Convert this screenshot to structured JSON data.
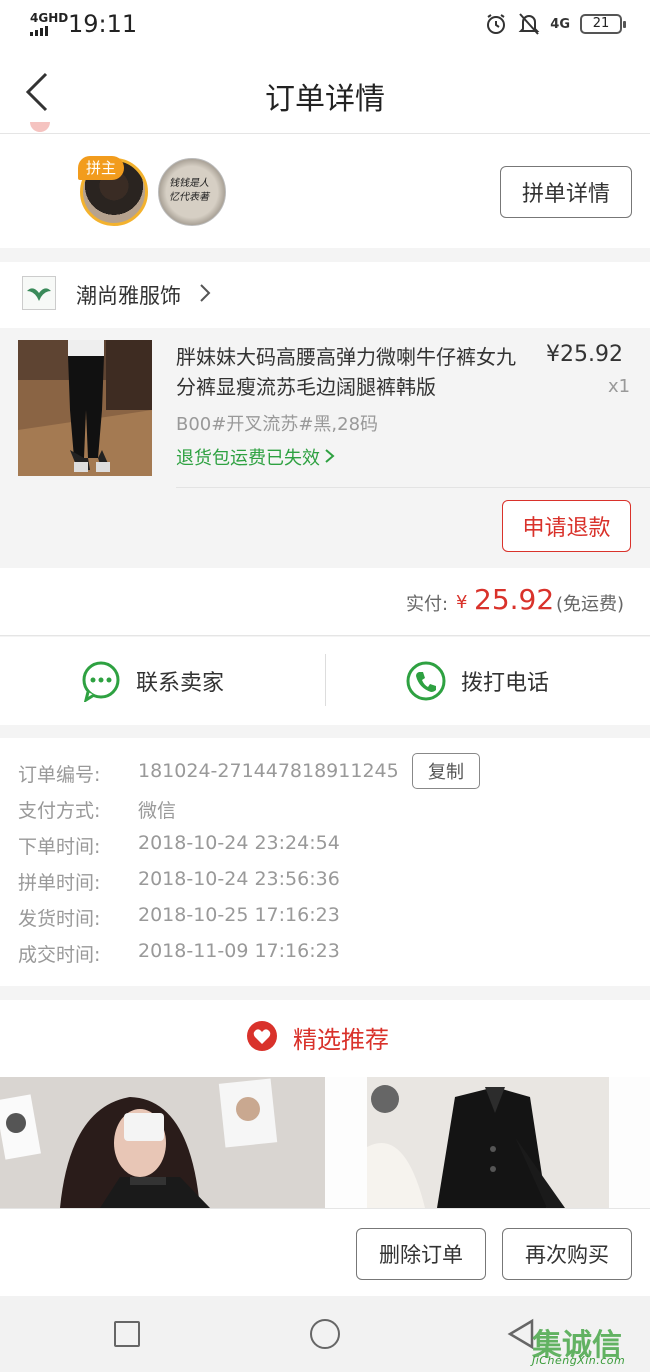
{
  "status_bar": {
    "network": "4GHD",
    "time": "19:11",
    "net_right": "4G",
    "battery": "21"
  },
  "nav": {
    "title": "订单详情"
  },
  "group": {
    "host_tag": "拼主",
    "detail_button": "拼单详情",
    "avatar2_text": "钱钱是人 忆代表著"
  },
  "store": {
    "name": "潮尚雅服饰"
  },
  "product": {
    "title": "胖妹妹大码高腰高弹力微喇牛仔裤女九分裤显瘦流苏毛边阔腿裤韩版",
    "price": "¥25.92",
    "quantity": "x1",
    "spec": "B00#开叉流苏#黑,28码",
    "shipping_note": "退货包运费已失效",
    "refund_button": "申请退款"
  },
  "payment": {
    "label": "实付:",
    "currency": "¥",
    "amount": "25.92",
    "shipping": "(免运费)"
  },
  "contact": {
    "seller_label": "联系卖家",
    "phone_label": "拨打电话"
  },
  "order_info": {
    "copy_button": "复制",
    "rows": [
      {
        "key": "订单编号:",
        "value": "181024-271447818911245"
      },
      {
        "key": "支付方式:",
        "value": "微信"
      },
      {
        "key": "下单时间:",
        "value": "2018-10-24 23:24:54"
      },
      {
        "key": "拼单时间:",
        "value": "2018-10-24 23:56:36"
      },
      {
        "key": "发货时间:",
        "value": "2018-10-25 17:16:23"
      },
      {
        "key": "成交时间:",
        "value": "2018-11-09 17:16:23"
      }
    ]
  },
  "recommend": {
    "title": "精选推荐"
  },
  "actions": {
    "delete": "删除订单",
    "rebuy": "再次购买"
  },
  "watermark": {
    "big": "集诚信",
    "small": "JiChengXin.com"
  },
  "colors": {
    "accent_red": "#d9322b",
    "green": "#2ea141",
    "host_orange": "#f29c1d"
  }
}
